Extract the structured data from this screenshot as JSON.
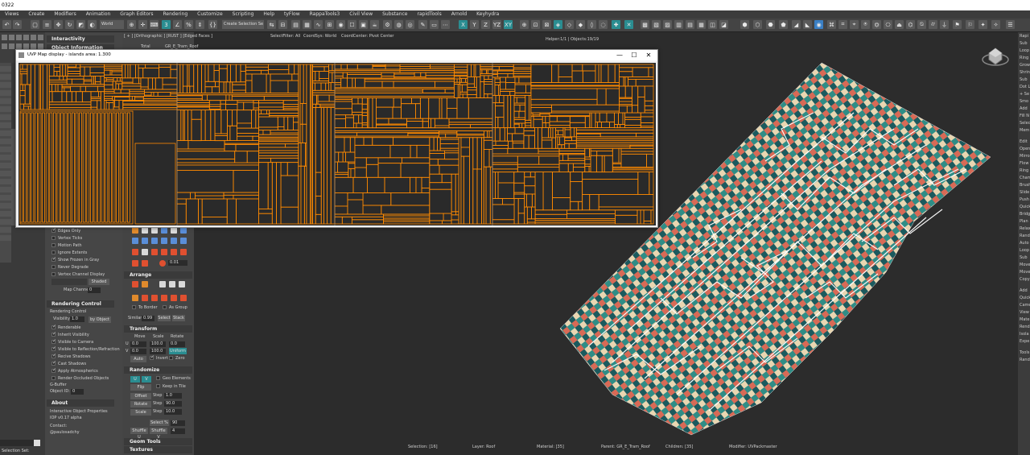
{
  "title_bar": {
    "title": "0322"
  },
  "menu": [
    "Views",
    "Create",
    "Modifiers",
    "Animation",
    "Graph Editors",
    "Rendering",
    "Customize",
    "Scripting",
    "Help",
    "tyFlow",
    "RappaTools3",
    "Civil View",
    "Substance",
    "rapidTools",
    "Arnold",
    "Keyhydra"
  ],
  "toolbar": {
    "ref_coord": "World",
    "named_selection": "Create Selection Se"
  },
  "left_panel": {
    "interactivity_header": "Interactivity",
    "object_info_header": "Object Information",
    "display_props": [
      {
        "label": "Edges Only",
        "checked": true
      },
      {
        "label": "Vertex Ticks",
        "checked": false
      },
      {
        "label": "Motion Path",
        "checked": false
      },
      {
        "label": "Ignore Extents",
        "checked": false
      },
      {
        "label": "Show Frozen in Gray",
        "checked": true
      },
      {
        "label": "Never Degrade",
        "checked": false
      },
      {
        "label": "Vertex Channel Display",
        "checked": false
      }
    ],
    "shaded_label": "Shaded",
    "map_channel_label": "Map Channel:",
    "map_channel_value": "0",
    "rendering_control_header": "Rendering Control",
    "rendering_control_sub": "Rendering Control",
    "visibility_label": "Visibility:",
    "visibility_value": "1.0",
    "by_object_label": "by Object",
    "render_props": [
      {
        "label": "Renderable",
        "checked": true
      },
      {
        "label": "Inherit Visibility",
        "checked": true
      },
      {
        "label": "Visible to Camera",
        "checked": true
      },
      {
        "label": "Visible to Reflection/Refraction",
        "checked": true
      },
      {
        "label": "Recive Shadows",
        "checked": true
      },
      {
        "label": "Cast Shadows",
        "checked": true
      },
      {
        "label": "Apply Atmospherics",
        "checked": true
      },
      {
        "label": "Render Occluded Objects",
        "checked": false
      }
    ],
    "gbuffer_label": "G-Buffer",
    "object_id_label": "Object ID:",
    "object_id_value": "0",
    "about_header": "About",
    "about_line1": "Interactive Object Properties",
    "about_line2": "IOP v0.17 alpha",
    "contact_label": "Contact:",
    "contact_value": "@paulosadchy",
    "status_text": "Selection Set:"
  },
  "mid_panel": {
    "value_001": "0.01",
    "arrange_header": "Arrange",
    "to_border": "To Border",
    "as_group": "As Group",
    "similar_label": "Similar",
    "similar_value": "0.99",
    "select_label": "Select",
    "stack_label": "Stack",
    "transform_header": "Transform",
    "move_label": "Move",
    "scale_label": "Scale",
    "rotate_label": "Rotate",
    "u_row": [
      "0.0",
      "100.0",
      "0.0"
    ],
    "v_row": [
      "0.0",
      "100.0"
    ],
    "uniform_label": "Uniform",
    "auto_label": "Auto",
    "invert_label": "Invert",
    "zero_label": "Zero",
    "randomize_header": "Randomize",
    "uv_label": "U",
    "v_label": "V",
    "geo_elements": "Geo Elements",
    "flip_label": "Flip",
    "keep_in_tile": "Keep in Tile",
    "offset_label": "Offset",
    "step_label": "Step",
    "offset_step": "1.0",
    "rotate_r_label": "Rotate",
    "rotate_step": "90.0",
    "scale_r_label": "Scale",
    "scale_step": "10.0",
    "select_pct_label": "Select %",
    "select_pct_value": "90",
    "shuffle_u": "Shuffle U",
    "shuffle_v": "Shuffle V",
    "shuffle_value": "4",
    "geom_tools_header": "Geom Tools",
    "textures_header": "Textures"
  },
  "viewport": {
    "label": "[ + ] [Orthographic ] [RUST ] [Edged Faces ]",
    "select_filter": "SelectFilter: All",
    "coord_sys": "CoordSys: World",
    "coord_center": "CoordCenter: Pivot Center",
    "helper_info": "Helper:1/1 | Objects:19/19",
    "total_label": "Total",
    "object_name": "GR_E_Tram_Roof",
    "bottom_info": [
      "Selection: [16]",
      "Layer: Roof",
      "Material: [35]",
      "Parent: GR_E_Tram_Roof",
      "Children: [35]",
      "Modifier: UVPackmaster"
    ]
  },
  "uv_window": {
    "title": "UVP Map display - islands area: 1.300",
    "minimize": "—",
    "maximize": "☐",
    "close": "✕"
  },
  "right_panel": {
    "items": [
      "Rapi",
      "Sub",
      "Loop",
      "Ring",
      "Grow",
      "Shrin",
      "Sub",
      "Dot L",
      "+ Se",
      "Smo",
      "Add",
      "Fill N",
      "Selec",
      "Mem",
      "Edit",
      "Open",
      "Mirro",
      "Flow",
      "Ring",
      "Cham",
      "Brush",
      "Slide",
      "Push",
      "Quick",
      "Bridg",
      "Plan",
      "Relax",
      "Rand",
      "Auto",
      "Loop",
      "Sub",
      "Move",
      "Move",
      "Copy",
      "Add",
      "Quick",
      "Came",
      "View",
      "Mate",
      "Rend",
      "Isola",
      "Expe",
      "Tools",
      "Rand"
    ]
  },
  "colors": {
    "uv_lines": "#ff8a00",
    "accent": "#2a8d91"
  }
}
